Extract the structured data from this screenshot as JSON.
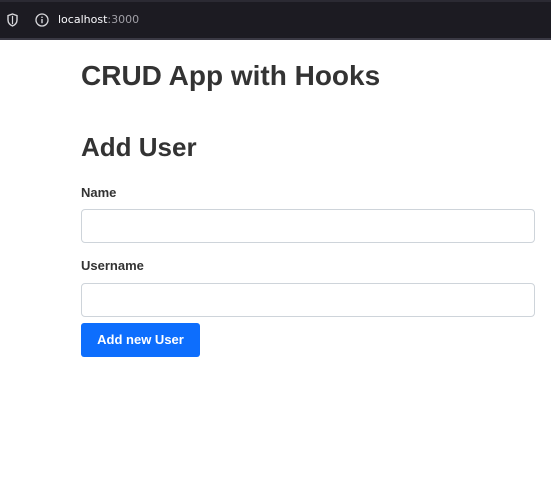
{
  "browser": {
    "url_host": "localhost",
    "url_port": ":3000"
  },
  "app": {
    "title": "CRUD App with Hooks"
  },
  "form": {
    "heading": "Add User",
    "name_label": "Name",
    "name_value": "",
    "username_label": "Username",
    "username_value": "",
    "submit_label": "Add new User"
  },
  "colors": {
    "primary": "#0d6efd",
    "heading_text": "#333333",
    "browser_chrome": "#1c1b22"
  },
  "icons": [
    "shield-icon",
    "info-icon"
  ]
}
